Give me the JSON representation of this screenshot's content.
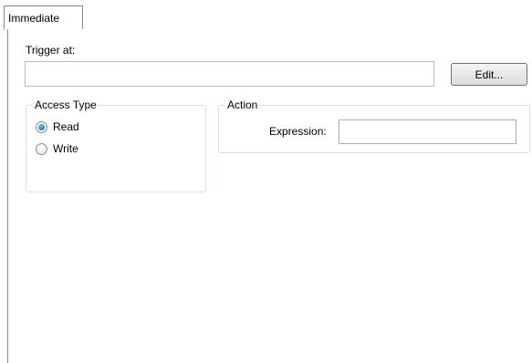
{
  "tabs": [
    {
      "label": "Immediate",
      "active": true
    }
  ],
  "trigger": {
    "label": "Trigger at:",
    "value": "",
    "edit_button": "Edit..."
  },
  "access_type": {
    "title": "Access Type",
    "options": [
      {
        "label": "Read",
        "checked": true
      },
      {
        "label": "Write",
        "checked": false
      }
    ]
  },
  "action": {
    "title": "Action",
    "expression_label": "Expression:",
    "expression_value": ""
  },
  "colors": {
    "border": "#8a8a8a",
    "input_border_focus": "#a9c1d9",
    "groupbox_border": "#d5dfe5",
    "radio_selected": "#1a5fa8"
  }
}
